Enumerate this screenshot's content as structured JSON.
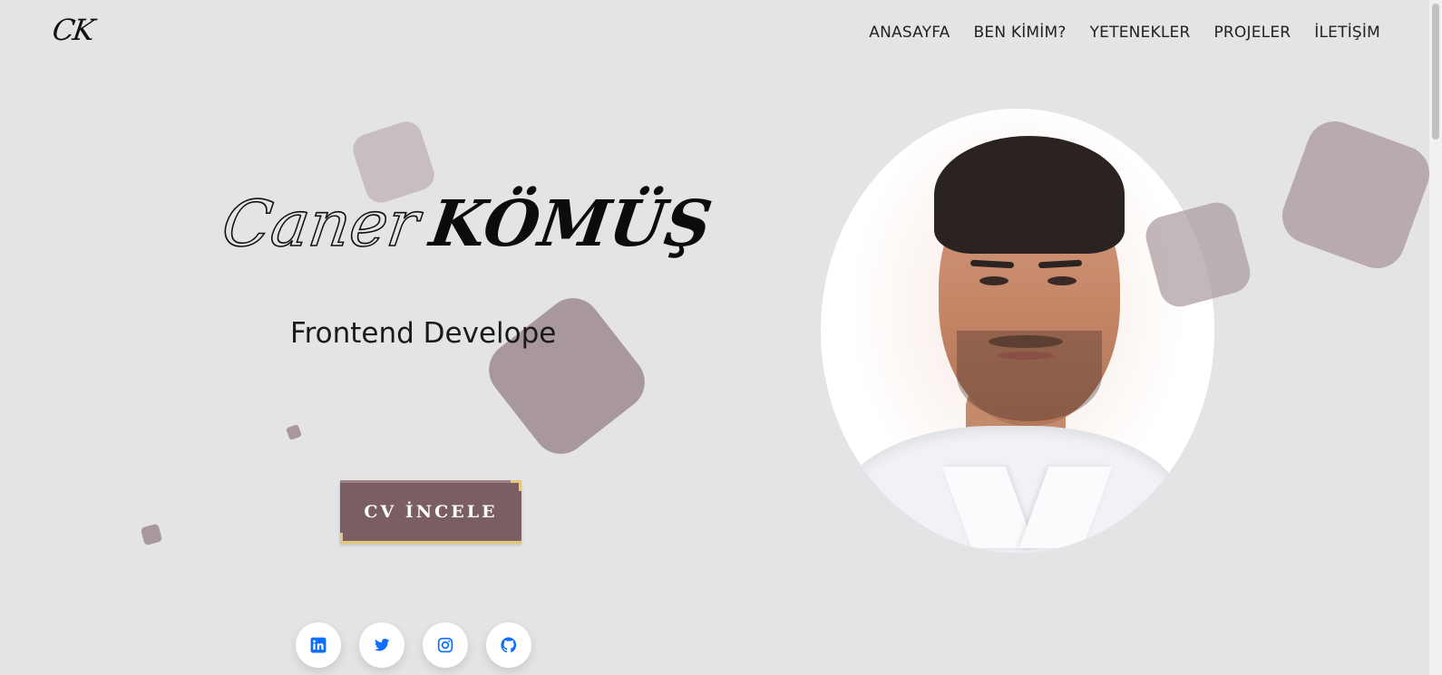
{
  "header": {
    "logo": "CK",
    "nav": [
      {
        "label": "ANASAYFA"
      },
      {
        "label": "BEN KİMİM?"
      },
      {
        "label": "YETENEKLER"
      },
      {
        "label": "PROJELER"
      },
      {
        "label": "İLETİŞİM"
      }
    ]
  },
  "hero": {
    "first_name": "Caner",
    "last_name": "KÖMÜŞ",
    "role": "Frontend Develope",
    "cv_button": "CV İNCELE"
  },
  "social": [
    {
      "name": "linkedin-icon"
    },
    {
      "name": "twitter-icon"
    },
    {
      "name": "instagram-icon"
    },
    {
      "name": "github-icon"
    }
  ],
  "colors": {
    "background": "#e4e4e6",
    "accent": "#7a5e63",
    "button_border": "#e4c77a",
    "icon_blue": "#0d6efd",
    "shape_light": "#c9bfc1",
    "shape_dark": "#a8989b"
  }
}
